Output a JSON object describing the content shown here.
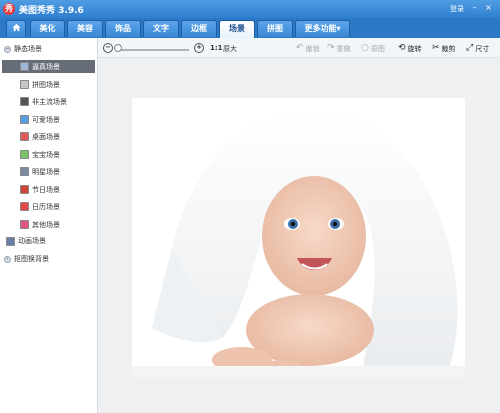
{
  "titlebar": {
    "app_icon_glyph": "秀",
    "title": "美图秀秀 3.9.6",
    "login": "登录",
    "minimize_icon": "minimize-icon",
    "close_icon": "close-icon"
  },
  "tabs": [
    {
      "label": "",
      "icon": "home-icon"
    },
    {
      "label": "美化"
    },
    {
      "label": "美容"
    },
    {
      "label": "饰品"
    },
    {
      "label": "文字"
    },
    {
      "label": "边框"
    },
    {
      "label": "场景"
    },
    {
      "label": "拼图"
    },
    {
      "label": "更多功能▾"
    }
  ],
  "active_tab": "场景",
  "sidebar": {
    "group_static": "静态场景",
    "items": [
      "逼真场景",
      "拼图场景",
      "非主流场景",
      "可爱场景",
      "桌面场景",
      "宝宝场景",
      "明星场景",
      "节日场景",
      "日历场景",
      "其他场景"
    ],
    "selected": "逼真场景",
    "group_animated": "动画场景",
    "group_cutout": "抠图换背景",
    "colors": {
      "selected_bg": "#666d78"
    }
  },
  "toolbar": {
    "zoom_out_icon": "zoom-out-icon",
    "zoom_in_icon": "zoom-in-icon",
    "ratio_label": "1:1",
    "original_size": "原大",
    "undo": "撤销",
    "redo": "重做",
    "original_image": "原图",
    "rotate": "旋转",
    "crop": "裁剪",
    "resize": "尺寸"
  },
  "colors": {
    "titlebar": "#2f7fd0",
    "tabbar": "#2c78c6",
    "canvas_bg": "#eef0f2"
  }
}
